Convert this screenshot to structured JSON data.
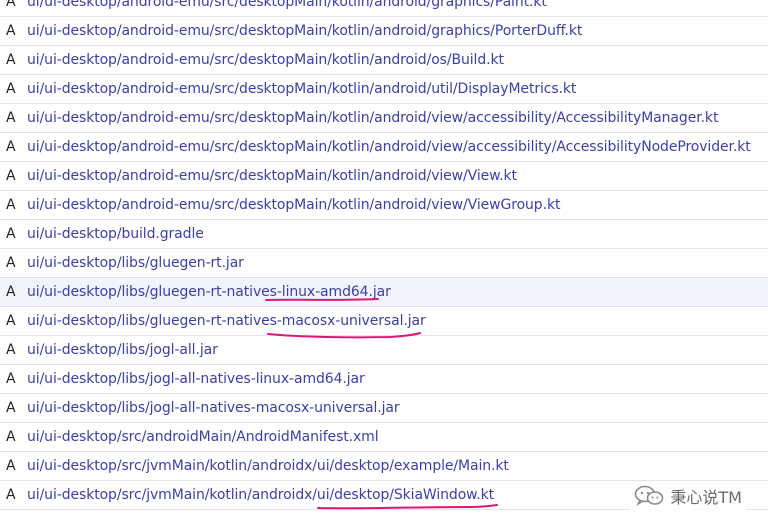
{
  "files": [
    {
      "status": "A",
      "path": "ui/ui-desktop/android-emu/src/desktopMain/kotlin/android/graphics/Paint.kt"
    },
    {
      "status": "A",
      "path": "ui/ui-desktop/android-emu/src/desktopMain/kotlin/android/graphics/PorterDuff.kt"
    },
    {
      "status": "A",
      "path": "ui/ui-desktop/android-emu/src/desktopMain/kotlin/android/os/Build.kt"
    },
    {
      "status": "A",
      "path": "ui/ui-desktop/android-emu/src/desktopMain/kotlin/android/util/DisplayMetrics.kt"
    },
    {
      "status": "A",
      "path": "ui/ui-desktop/android-emu/src/desktopMain/kotlin/android/view/accessibility/AccessibilityManager.kt"
    },
    {
      "status": "A",
      "path": "ui/ui-desktop/android-emu/src/desktopMain/kotlin/android/view/accessibility/AccessibilityNodeProvider.kt"
    },
    {
      "status": "A",
      "path": "ui/ui-desktop/android-emu/src/desktopMain/kotlin/android/view/View.kt"
    },
    {
      "status": "A",
      "path": "ui/ui-desktop/android-emu/src/desktopMain/kotlin/android/view/ViewGroup.kt"
    },
    {
      "status": "A",
      "path": "ui/ui-desktop/build.gradle"
    },
    {
      "status": "A",
      "path": "ui/ui-desktop/libs/gluegen-rt.jar"
    },
    {
      "status": "A",
      "path": "ui/ui-desktop/libs/gluegen-rt-natives-linux-amd64.jar"
    },
    {
      "status": "A",
      "path": "ui/ui-desktop/libs/gluegen-rt-natives-macosx-universal.jar"
    },
    {
      "status": "A",
      "path": "ui/ui-desktop/libs/jogl-all.jar"
    },
    {
      "status": "A",
      "path": "ui/ui-desktop/libs/jogl-all-natives-linux-amd64.jar"
    },
    {
      "status": "A",
      "path": "ui/ui-desktop/libs/jogl-all-natives-macosx-universal.jar"
    },
    {
      "status": "A",
      "path": "ui/ui-desktop/src/androidMain/AndroidManifest.xml"
    },
    {
      "status": "A",
      "path": "ui/ui-desktop/src/jvmMain/kotlin/androidx/ui/desktop/example/Main.kt"
    },
    {
      "status": "A",
      "path": "ui/ui-desktop/src/jvmMain/kotlin/androidx/ui/desktop/SkiaWindow.kt"
    }
  ],
  "watermark": {
    "text": "秉心说TM",
    "icon": "wechat-icon"
  },
  "colors": {
    "link": "#3b3fa8",
    "annotation": "#e0157a",
    "row_border": "#e4e4ea",
    "hover_row": "#f2f4fb"
  }
}
